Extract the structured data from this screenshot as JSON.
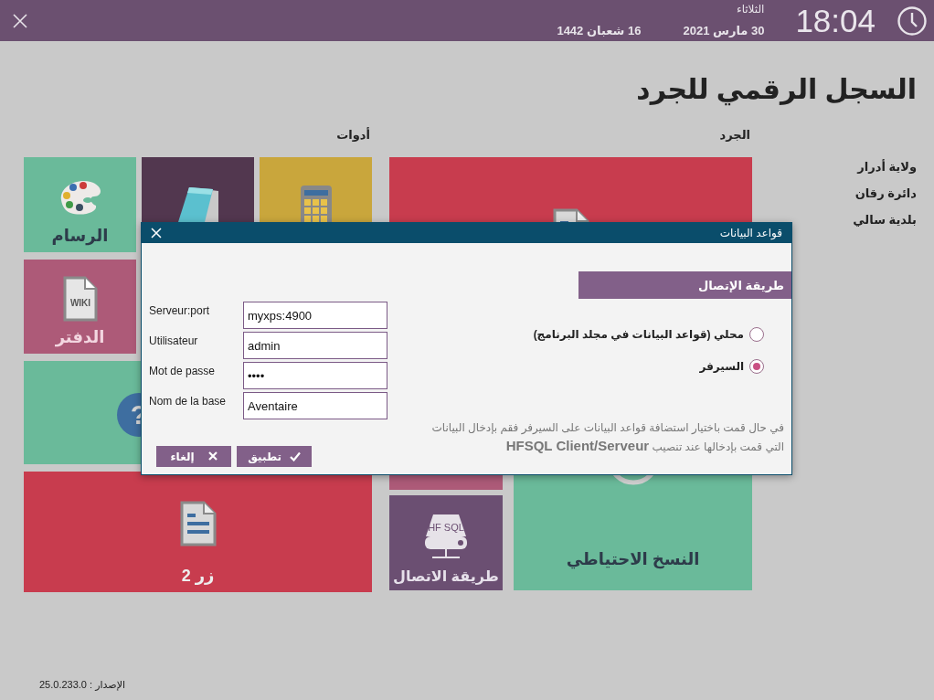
{
  "top_bar": {
    "time": "18:04",
    "day": "الثلاثاء",
    "date": "30 مارس 2021",
    "hijri_date": "16 شعبان 1442"
  },
  "title": "السجل الرقمي للجرد",
  "location": [
    "ولاية أدرار",
    "دائرة رقان",
    "بلدية سالي"
  ],
  "groups": [
    {
      "label": "الجرد",
      "tiles": [
        {
          "kind": "document",
          "color": "#c83c4e"
        },
        {
          "kind": "blank",
          "color": "#ad5a78"
        },
        {
          "kind": "server",
          "label": "طريقة الاتصال",
          "icon_text": "HF SQL",
          "color": "#6b4f72"
        },
        {
          "kind": "backup",
          "label": "النسخ الاحتياطي",
          "color": "#6aba9a"
        }
      ]
    },
    {
      "label": "أدوات",
      "tiles": [
        {
          "kind": "paint",
          "label": "الرسام",
          "color": "#6aba9a"
        },
        {
          "kind": "notepad",
          "color": "#52374f"
        },
        {
          "kind": "calculator",
          "color": "#c9a63c"
        },
        {
          "kind": "wiki",
          "label": "الدفتر",
          "icon_text": "WIKI",
          "color": "#ad5a78"
        },
        {
          "kind": "help",
          "icon_text": "?",
          "color": "#6aba9a"
        },
        {
          "kind": "document",
          "label": "زر 2",
          "color": "#c83c4e"
        }
      ]
    }
  ],
  "dialog": {
    "title": "قواعد البيانات",
    "section": "طريقة الإتصال",
    "fields": [
      {
        "label": "Serveur:port",
        "value": "myxps:4900"
      },
      {
        "label": "Utilisateur",
        "value": "admin"
      },
      {
        "label": "Mot de passe",
        "value": "••••"
      },
      {
        "label": "Nom de la base",
        "value": "Aventaire"
      }
    ],
    "options": [
      {
        "label": "محلي (قواعد البيانات في مجلد البرنامج)",
        "selected": false
      },
      {
        "label": "السيرفر",
        "selected": true
      }
    ],
    "note": "في حال قمت باختيار استضافة قواعد البيانات على السيرفر فقم بإدخال البيانات التي قمت بإدخالها عند تنصيب **HFSQL Client/Serveur**",
    "buttons": [
      {
        "kind": "apply",
        "label": "تطبيق"
      },
      {
        "kind": "cancel",
        "label": "إلغاء"
      }
    ]
  },
  "version": "الإصدار : 25.0.233.0"
}
